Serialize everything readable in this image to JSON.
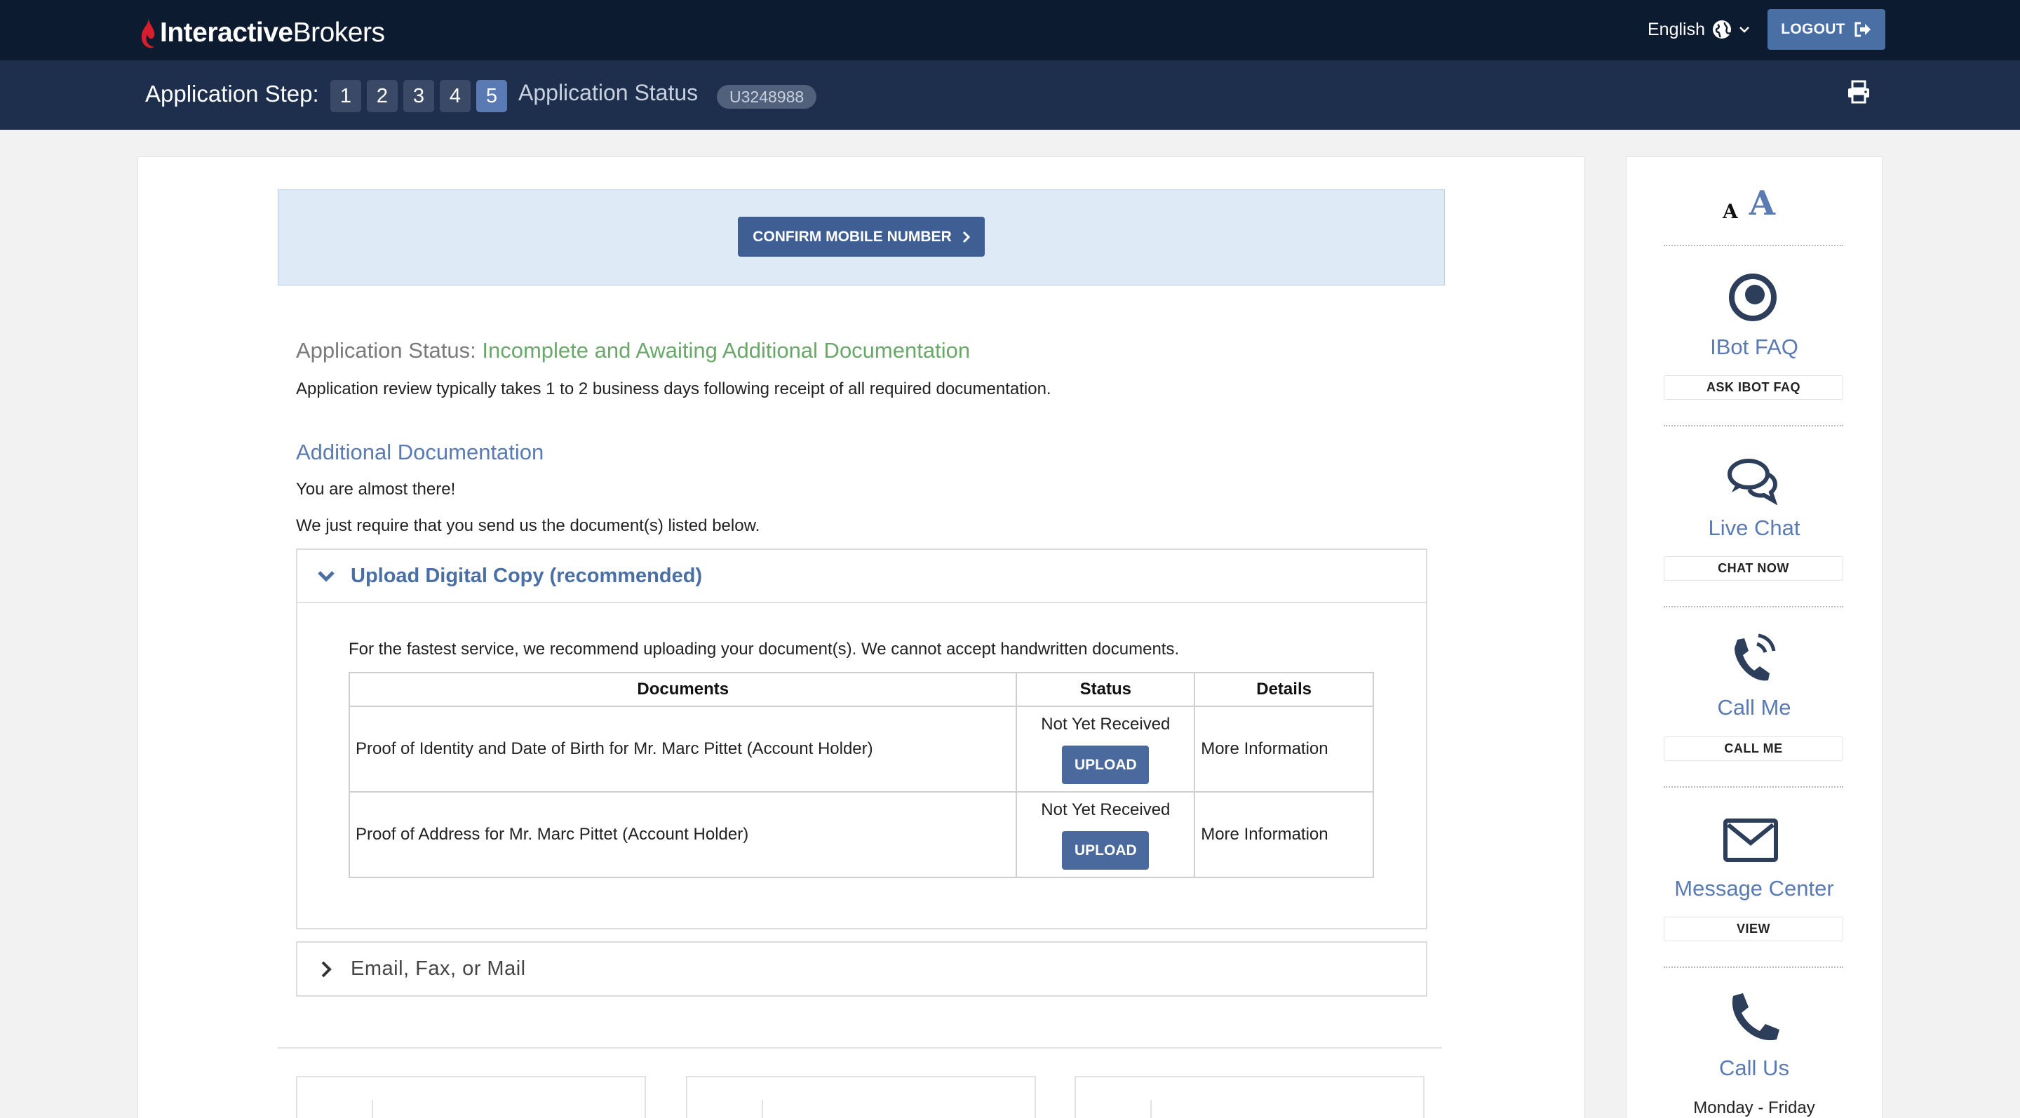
{
  "header": {
    "brand_bold": "Interactive",
    "brand_light": "Brokers",
    "language": "English",
    "logout_label": "LOGOUT"
  },
  "stepbar": {
    "label": "Application Step:",
    "steps": [
      "1",
      "2",
      "3",
      "4",
      "5"
    ],
    "active_step": "5",
    "title": "Application Status",
    "account_id": "U3248988"
  },
  "main": {
    "confirm_label": "CONFIRM MOBILE NUMBER",
    "status_prefix": "Application Status:",
    "status_value": "Incomplete and Awaiting Additional Documentation",
    "review_text": "Application review typically takes 1 to 2 business days following receipt of all required documentation.",
    "addl_title": "Additional Documentation",
    "almost_text": "You are almost there!",
    "require_text": "We just require that you send us the document(s) listed below.",
    "upload_panel": {
      "title": "Upload Digital Copy (recommended)",
      "intro": "For the fastest service, we recommend uploading your document(s). We cannot accept handwritten documents.",
      "columns": [
        "Documents",
        "Status",
        "Details"
      ],
      "rows": [
        {
          "document": "Proof of Identity and Date of Birth for Mr. Marc Pittet (Account Holder)",
          "status": "Not Yet Received",
          "button": "UPLOAD",
          "details": "More Information"
        },
        {
          "document": "Proof of Address for Mr. Marc Pittet (Account Holder)",
          "status": "Not Yet Received",
          "button": "UPLOAD",
          "details": "More Information"
        }
      ]
    },
    "mail_panel_title": "Email, Fax, or Mail"
  },
  "sidebar": {
    "font_small": "A",
    "font_large": "A",
    "items": [
      {
        "icon": "ibot-icon",
        "title": "IBot FAQ",
        "button": "ASK IBOT FAQ"
      },
      {
        "icon": "chat-bubbles-icon",
        "title": "Live Chat",
        "button": "CHAT NOW"
      },
      {
        "icon": "phone-ringing-icon",
        "title": "Call Me",
        "button": "CALL ME"
      },
      {
        "icon": "envelope-icon",
        "title": "Message Center",
        "button": "VIEW"
      },
      {
        "icon": "phone-icon",
        "title": "Call Us",
        "hours": "Monday - Friday"
      }
    ]
  },
  "colors": {
    "topbar": "#0d1b30",
    "stepbar": "#1e2f4e",
    "accent": "#4a6fa5",
    "status_green": "#6aa86a",
    "logo_red": "#d81e2c"
  }
}
